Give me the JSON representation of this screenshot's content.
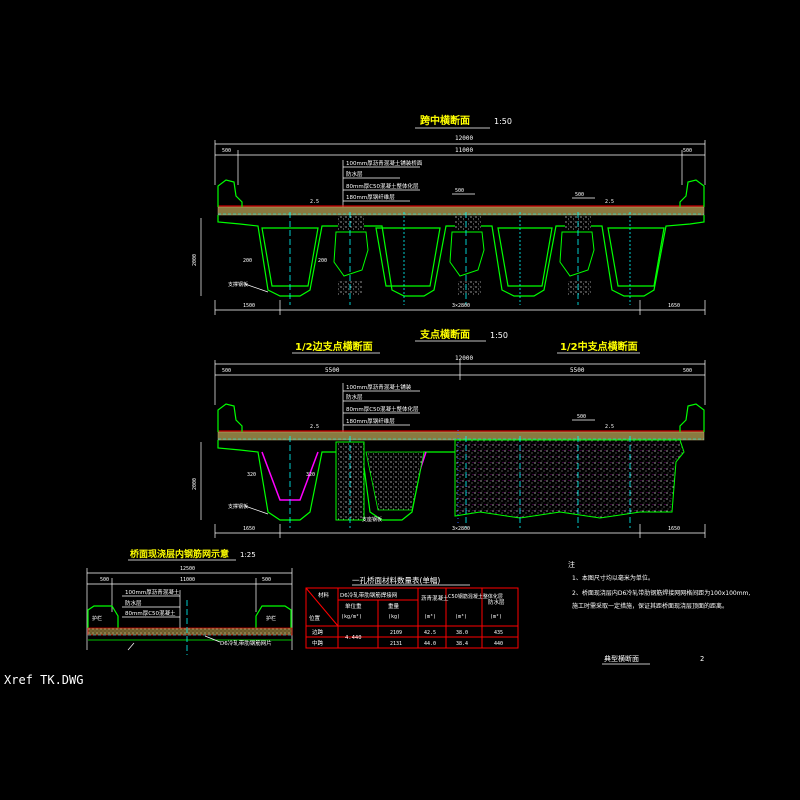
{
  "section1": {
    "title": "跨中横断面",
    "scale": "1:50",
    "dims_top": [
      "12000",
      "11000",
      "500",
      "500"
    ],
    "layers": [
      "100mm厚沥青混凝土铺装桥面",
      "防水层",
      "80mm厚C50混凝土整体化层",
      "180mm厚钢纤维层"
    ],
    "marks": [
      "500",
      "500",
      "2.5",
      "2.5"
    ],
    "left_labels": [
      "2000",
      "200",
      "200",
      "支撑钢板"
    ],
    "dims_bottom": [
      "1500",
      "3×2800",
      "1650"
    ]
  },
  "section2": {
    "title": "支点横断面",
    "scale": "1:50",
    "left_title": "1/2边支点横断面",
    "right_title": "1/2中支点横断面",
    "dims_top": [
      "12000",
      "5500",
      "5500",
      "500",
      "500"
    ],
    "layers": [
      "100mm厚沥青混凝土铺装",
      "防水层",
      "80mm厚C50混凝土整体化层",
      "180mm厚钢纤维层"
    ],
    "marks": [
      "500",
      "2.5",
      "2.5"
    ],
    "left_labels": [
      "2000",
      "320",
      "320",
      "支撑钢板",
      "支座钢板"
    ],
    "dims_bottom": [
      "1650",
      "3×2800",
      "1650"
    ]
  },
  "section3": {
    "title": "桥面现浇层内钢筋网示意",
    "scale": "1:25",
    "dims_top": [
      "12500",
      "500",
      "11000",
      "500"
    ],
    "labels": [
      "100mm厚沥青混凝土",
      "防水层",
      "80mm厚C50混凝土",
      "D6冷轧带肋钢筋网片",
      "护栏",
      "护栏"
    ]
  },
  "table": {
    "title": "一孔桥面材料数量表(单幅)",
    "headers": [
      "材料",
      "D6冷轧带肋钢筋焊接网",
      "沥青混凝土",
      "C50钢筋混凝土整体化层",
      "防水层"
    ],
    "subheaders": [
      "单位重",
      "重量",
      "沥青",
      "C50"
    ],
    "units": [
      "(kg/m²)",
      "(kg)",
      "(m³)",
      "(m³)",
      "(m²)"
    ],
    "row_label_header": "位置",
    "unit_weight": "4.440",
    "rows": [
      {
        "label": "边跨",
        "weight": "2109",
        "asphalt": "42.5",
        "c50": "38.0",
        "waterproof": "435"
      },
      {
        "label": "中跨",
        "weight": "2131",
        "asphalt": "44.0",
        "c50": "38.4",
        "waterproof": "440"
      }
    ]
  },
  "notes": {
    "title": "注",
    "items": [
      "1、本图尺寸均以毫米为单位。",
      "2、桥面现浇层内D6冷轧带肋钢筋焊接网网格间距为100x100mm,",
      "   施工时需采取一定措施，保证其距桥面现浇层顶面的距离。"
    ]
  },
  "drawing_title": "典型横断面",
  "sheet_no": "2",
  "xref": "Xref TK.DWG"
}
